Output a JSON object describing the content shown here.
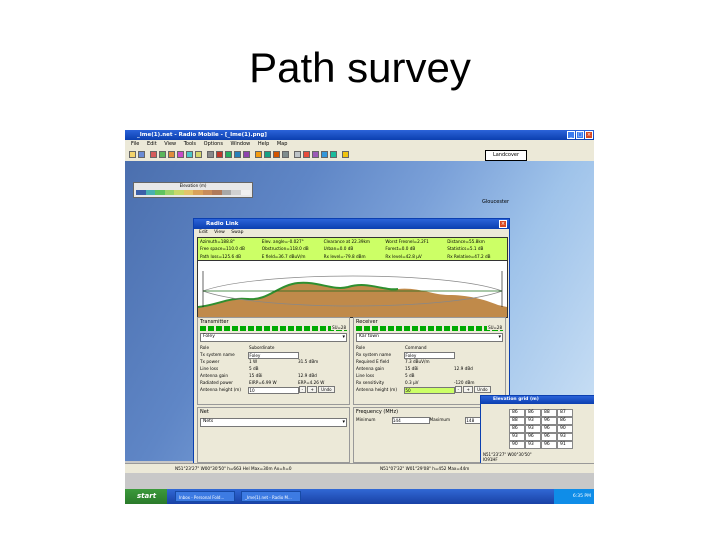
{
  "slide": {
    "title": "Path survey"
  },
  "app": {
    "title": "_Ime(1).net - Radio Mobile - [_Ime(1).png]",
    "menu": [
      "File",
      "Edit",
      "View",
      "Tools",
      "Options",
      "Window",
      "Help",
      "Map"
    ],
    "landcover_label": "Landcover",
    "legend_title": "Elevation (m)",
    "place_label": "Gloucester"
  },
  "radio_link": {
    "title": "Radio Link",
    "menu": [
      "Edit",
      "View",
      "Swap"
    ],
    "stats": [
      "Azimuth=188.8°",
      "Elev. angle=-0.027°",
      "Clearance at 22.39km",
      "Worst Fresnel=2.2F1",
      "Distance=55.8km",
      "Free space=110.0 dB",
      "Obstruction=118.0 dB",
      "Urban=0.0 dB",
      "Forest=0.0 dB",
      "Statistics=5.1 dB",
      "Path loss=125.6 dB",
      "E field=36.7 dBuV/m",
      "Rx level=-79.8 dBm",
      "Rx level=42.8 µV",
      "Rx Relative=47.2 dB"
    ],
    "transmitter": {
      "heading": "Transmitter",
      "signal": "SU=28",
      "site": "Foley",
      "labels": [
        "Role",
        "Tx system name",
        "Tx power",
        "Line loss",
        "Antenna gain",
        "Radiated power",
        "Antenna height (m)"
      ],
      "values": [
        "Subordinate",
        "Foley",
        "1 W",
        "5 dB",
        "15 dBi",
        "EIRP=6.99 W",
        "10"
      ],
      "extras": [
        "",
        "",
        "31.5 dBm",
        "",
        "12.9 dBd",
        "ERP=4.26 W",
        ""
      ],
      "undo_label": "Undo"
    },
    "receiver": {
      "heading": "Receiver",
      "signal": "SU=28",
      "site": "Kar town",
      "labels": [
        "Role",
        "Rx system name",
        "Required E field",
        "Antenna gain",
        "Line loss",
        "Rx sensitivity",
        "Antenna height (m)"
      ],
      "values": [
        "Command",
        "Foley",
        "7.3 dBuV/m",
        "15 dBi",
        "5 dB",
        "0.3 µV",
        "50"
      ],
      "extras": [
        "",
        "",
        "",
        "12.9 dBd",
        "",
        "-120 dBm",
        ""
      ],
      "undo_label": "Undo"
    },
    "net": {
      "heading": "Net",
      "value": "Nets"
    },
    "frequency": {
      "heading": "Frequency (MHz)",
      "min_label": "Minimum",
      "min": "144",
      "max_label": "Maximum",
      "max": "148"
    }
  },
  "side_window": {
    "title": "Elevation grid (m)",
    "grid": [
      "86",
      "86",
      "88",
      "87",
      "88",
      "93",
      "96",
      "86",
      "86",
      "93",
      "96",
      "90",
      "93",
      "96",
      "96",
      "93",
      "90",
      "93",
      "96",
      "91"
    ],
    "foot": "N51°23'27\" W00°30'50\"",
    "foot2": "IO91HF"
  },
  "status": {
    "left": "N51°23'27\" W00°30'50\" h=663 Hel Max=30m Ax=h=0",
    "right": "N51°07'32\" W01°29'08\" h=452 Max=44m"
  },
  "taskbar": {
    "start": "start",
    "tasks": [
      "Inbox - Personal Fold...",
      "_Ime(1).net - Radio M..."
    ],
    "clock": "6:35 PM"
  }
}
